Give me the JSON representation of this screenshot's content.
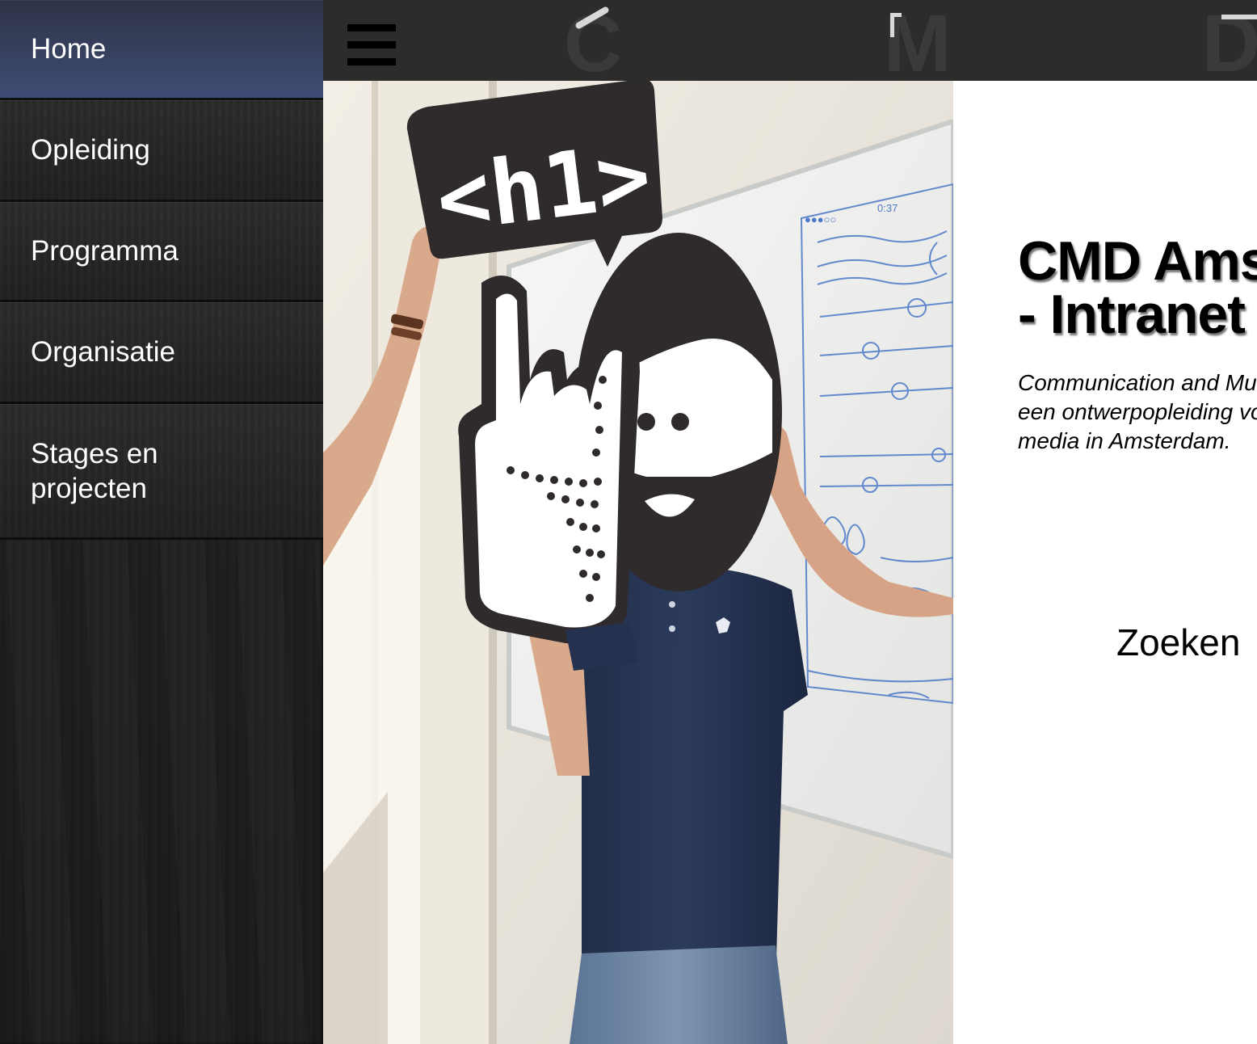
{
  "sidebar": {
    "items": [
      {
        "label": "Home",
        "active": true
      },
      {
        "label": "Opleiding"
      },
      {
        "label": "Programma"
      },
      {
        "label": "Organisatie"
      },
      {
        "label": "Stages en projecten",
        "line1": "Stages en",
        "line2": "projecten"
      }
    ]
  },
  "header": {
    "menu_icon": "hamburger-icon",
    "logo_letters": [
      "C",
      "M",
      "D"
    ]
  },
  "hero": {
    "sign_text": "<h1>"
  },
  "content": {
    "title_line1": "CMD Amsterdam",
    "title_line2": "- Intranet",
    "tagline_line1": "Communication and Multimedia Design is",
    "tagline_line2": "een ontwerpopleiding voor digitale",
    "tagline_line3": "media in Amsterdam.",
    "search_label": "Zoeken"
  },
  "colors": {
    "sidebar_active": "#3f4c74",
    "sidebar_bg": "#222222",
    "topbar_bg": "#2c2c2b",
    "text": "#000000"
  }
}
